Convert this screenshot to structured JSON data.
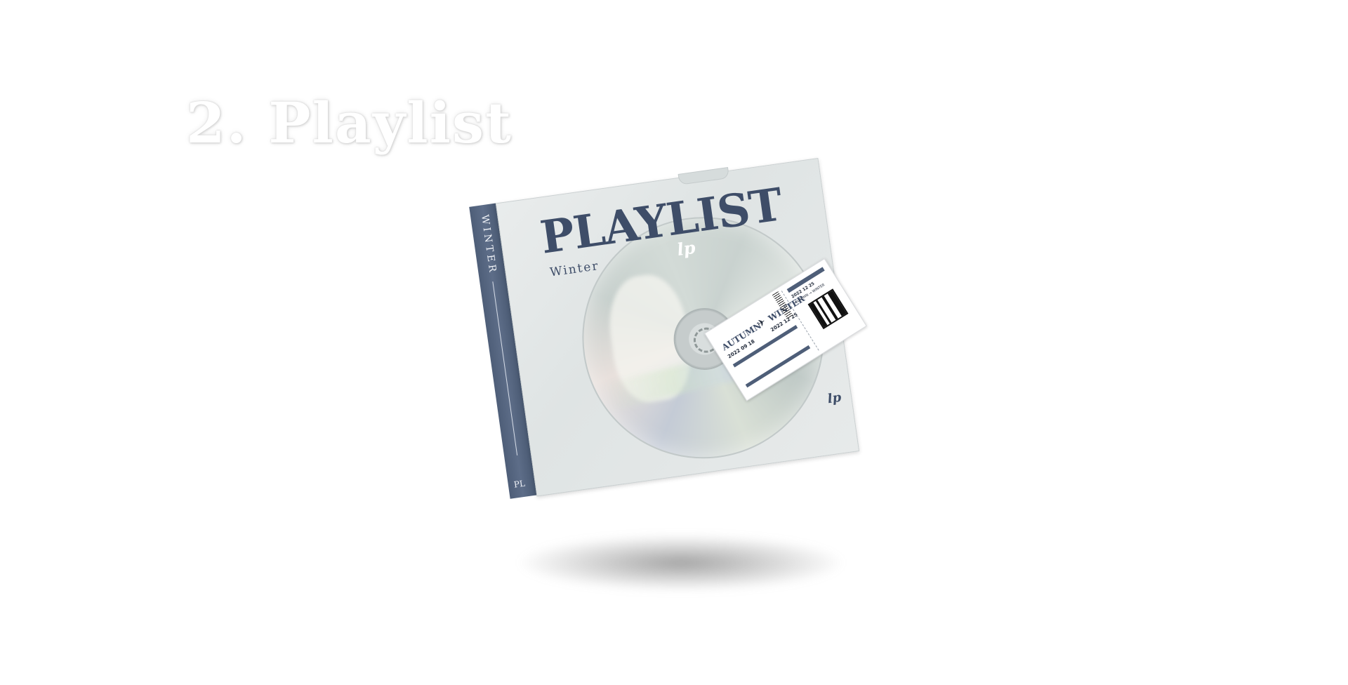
{
  "section": {
    "title": "2. Playlist"
  },
  "album": {
    "title": "PLAYLIST",
    "subtitle": "Winter",
    "spine_word": "WINTER",
    "spine_code": "PL",
    "logo": "lp",
    "fine_print": "",
    "colors": {
      "navy": "#3e4d68",
      "spine": "#4e5e78",
      "case": "#e3e7e7"
    }
  },
  "ticket": {
    "from": "AUTUMN",
    "to": "WINTER",
    "date_from": "2022 09 18",
    "date_to": "2022 12 25",
    "stub_date": "2022 12 25",
    "stub_route": "AUTUMN → WINTER",
    "plane_icon": "airplane-icon"
  }
}
